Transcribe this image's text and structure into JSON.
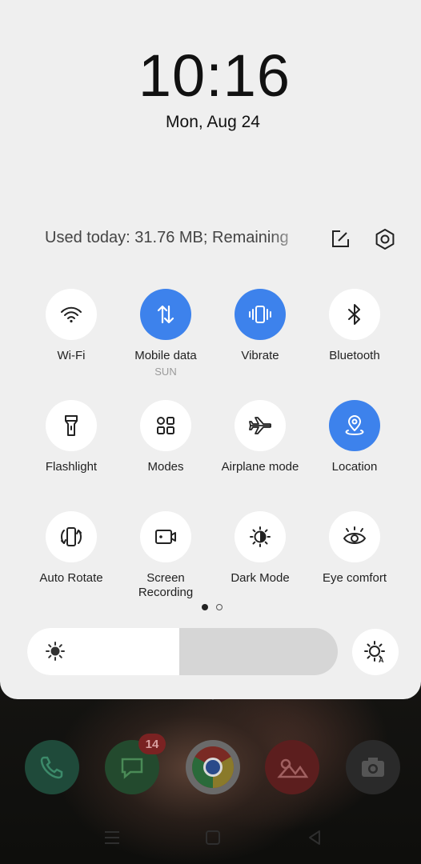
{
  "clock": {
    "time": "10:16",
    "date": "Mon, Aug 24"
  },
  "usage": {
    "text": "Used today: 31.76 MB; Remaining"
  },
  "header_icons": [
    "edit-icon",
    "settings-gear-icon"
  ],
  "accent_color": "#3d82ec",
  "tiles": [
    {
      "label": "Wi-Fi",
      "sublabel": "",
      "icon": "wifi-icon",
      "active": false
    },
    {
      "label": "Mobile data",
      "sublabel": "SUN",
      "icon": "mobile-data-icon",
      "active": true
    },
    {
      "label": "Vibrate",
      "sublabel": "",
      "icon": "vibrate-icon",
      "active": true
    },
    {
      "label": "Bluetooth",
      "sublabel": "",
      "icon": "bluetooth-icon",
      "active": false
    },
    {
      "label": "Flashlight",
      "sublabel": "",
      "icon": "flashlight-icon",
      "active": false
    },
    {
      "label": "Modes",
      "sublabel": "",
      "icon": "modes-grid-icon",
      "active": false
    },
    {
      "label": "Airplane mode",
      "sublabel": "",
      "icon": "airplane-icon",
      "active": false
    },
    {
      "label": "Location",
      "sublabel": "",
      "icon": "location-pin-icon",
      "active": true
    },
    {
      "label": "Auto Rotate",
      "sublabel": "",
      "icon": "auto-rotate-icon",
      "active": false
    },
    {
      "label": "Screen Recording",
      "sublabel": "",
      "icon": "screen-recording-icon",
      "active": false
    },
    {
      "label": "Dark Mode",
      "sublabel": "",
      "icon": "dark-mode-icon",
      "active": false
    },
    {
      "label": "Eye comfort",
      "sublabel": "",
      "icon": "eye-comfort-icon",
      "active": false
    }
  ],
  "pager": {
    "page": 1,
    "total": 2
  },
  "brightness": {
    "level": 0.49
  },
  "dock": {
    "apps": [
      "phone-app-icon",
      "messages-app-icon",
      "chrome-app-icon",
      "gallery-app-icon",
      "camera-app-icon"
    ],
    "messages_badge": "14"
  },
  "navbar": [
    "menu-icon",
    "home-icon",
    "back-icon"
  ]
}
